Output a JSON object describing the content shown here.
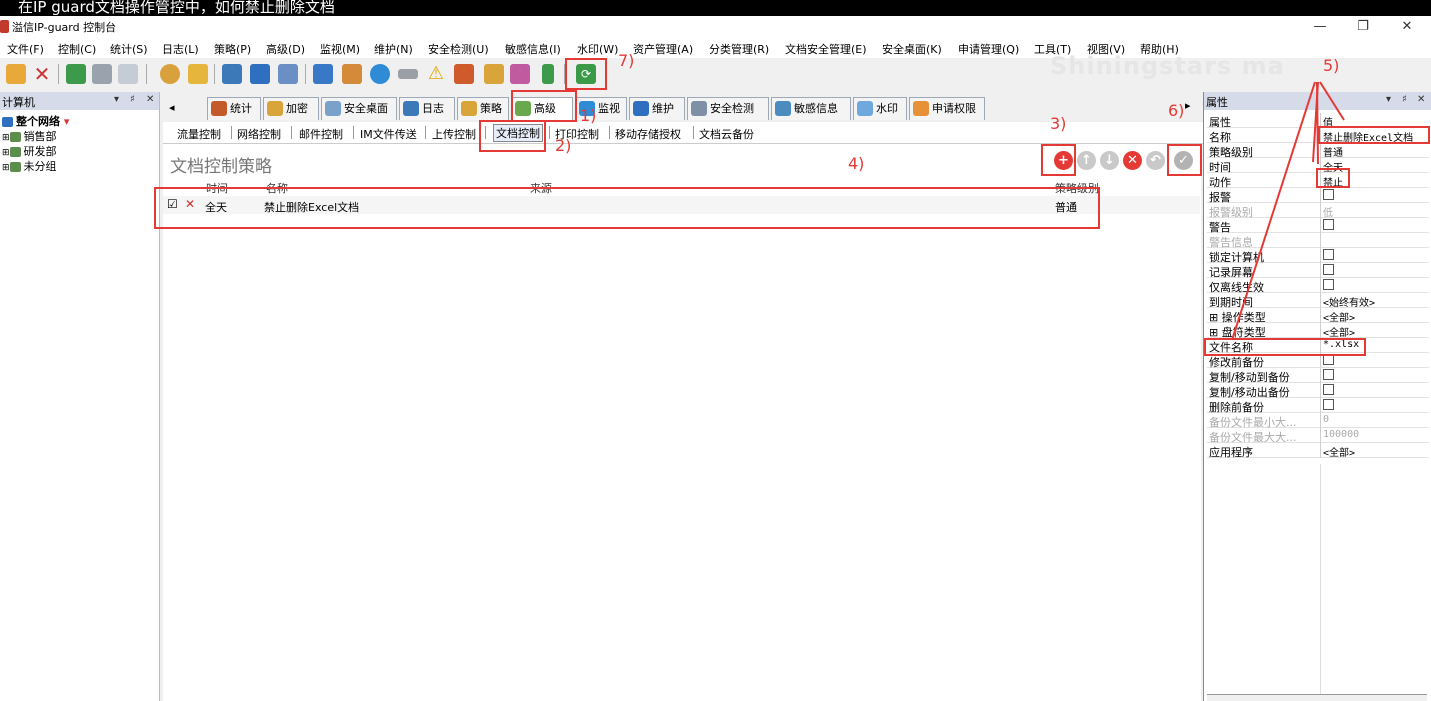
{
  "caption": "在IP guard文档操作管控中，如何禁止删除文档",
  "window": {
    "title": "溢信IP-guard 控制台",
    "min": "—",
    "max": "❐",
    "close": "✕"
  },
  "menu": [
    "文件(F)",
    "控制(C)",
    "统计(S)",
    "日志(L)",
    "策略(P)",
    "高级(D)",
    "监视(M)",
    "维护(N)",
    "安全检测(U)",
    "敏感信息(I)",
    "水印(W)",
    "资产管理(A)",
    "分类管理(R)",
    "文档安全管理(E)",
    "安全桌面(K)",
    "申请管理(Q)",
    "工具(T)",
    "视图(V)",
    "帮助(H)"
  ],
  "watermark": "Shiningstars ma",
  "left_panel": {
    "title": "计算机",
    "controls": [
      "▾",
      "♯",
      "✕"
    ],
    "tree": [
      "整个网络",
      "销售部",
      "研发部",
      "未分组"
    ]
  },
  "tabs": [
    "统计",
    "加密",
    "安全桌面",
    "日志",
    "策略",
    "高级",
    "监视",
    "维护",
    "安全检测",
    "敏感信息",
    "水印",
    "申请权限"
  ],
  "tab_scroll_left": "◂",
  "tab_scroll_right": "▸",
  "subtabs": [
    "流量控制",
    "网络控制",
    "邮件控制",
    "IM文件传送",
    "上传控制",
    "文档控制",
    "打印控制",
    "移动存储授权",
    "文档云备份"
  ],
  "center": {
    "title": "文档控制策略",
    "columns": [
      "时间",
      "名称",
      "来源",
      "策略级别"
    ],
    "rows": [
      {
        "check": "☑",
        "action": "✕",
        "time": "全天",
        "name": "禁止删除Excel文档",
        "source": "",
        "level": "普通"
      }
    ],
    "buttons": {
      "add": "+",
      "up": "↑",
      "down": "↓",
      "delete": "✕",
      "undo": "↶",
      "apply": "✓"
    }
  },
  "right_panel": {
    "title": "属性",
    "controls": [
      "▾",
      "♯",
      "✕"
    ],
    "header": {
      "k": "属性",
      "v": "值"
    },
    "rows": [
      {
        "k": "名称",
        "v": "禁止删除Excel文档"
      },
      {
        "k": "策略级别",
        "v": "普通"
      },
      {
        "k": "时间",
        "v": "全天"
      },
      {
        "k": "动作",
        "v": "禁止"
      },
      {
        "k": "报警",
        "v": ""
      },
      {
        "k": "报警级别",
        "v": "低"
      },
      {
        "k": "警告",
        "v": ""
      },
      {
        "k": "警告信息",
        "v": ""
      },
      {
        "k": "锁定计算机",
        "v": ""
      },
      {
        "k": "记录屏幕",
        "v": ""
      },
      {
        "k": "仅离线生效",
        "v": ""
      },
      {
        "k": "到期时间",
        "v": "<始终有效>"
      },
      {
        "k": "⊞ 操作类型",
        "v": "<全部>"
      },
      {
        "k": "⊞ 盘符类型",
        "v": "<全部>"
      },
      {
        "k": "文件名称",
        "v": "*.xlsx"
      },
      {
        "k": "修改前备份",
        "v": ""
      },
      {
        "k": "复制/移动到备份",
        "v": ""
      },
      {
        "k": "复制/移动出备份",
        "v": ""
      },
      {
        "k": "删除前备份",
        "v": ""
      },
      {
        "k": "备份文件最小大...",
        "v": "0"
      },
      {
        "k": "备份文件最大大...",
        "v": "100000"
      },
      {
        "k": "应用程序",
        "v": "<全部>"
      }
    ]
  },
  "annotations": [
    "1)",
    "2)",
    "3)",
    "4)",
    "5)",
    "6)",
    "7)"
  ],
  "colors": {
    "accent_red": "#e53935",
    "panel_head": "#d6dbe9"
  }
}
